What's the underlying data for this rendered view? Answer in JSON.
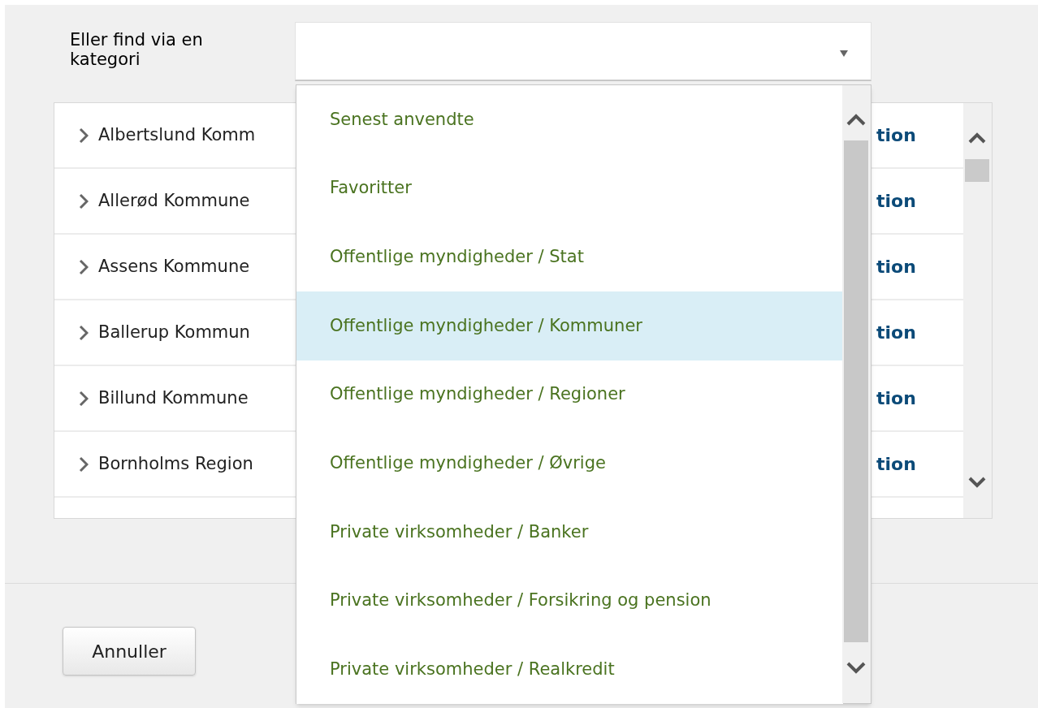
{
  "category_label": "Eller find via en kategori",
  "category_select": {
    "expanded": true
  },
  "dropdown_options": [
    {
      "label": "Senest anvendte",
      "selected": false
    },
    {
      "label": "Favoritter",
      "selected": false
    },
    {
      "label": "Offentlige myndigheder / Stat",
      "selected": false
    },
    {
      "label": "Offentlige myndigheder / Kommuner",
      "selected": true
    },
    {
      "label": "Offentlige myndigheder / Regioner",
      "selected": false
    },
    {
      "label": "Offentlige myndigheder / Øvrige",
      "selected": false
    },
    {
      "label": "Private virksomheder / Banker",
      "selected": false
    },
    {
      "label": "Private virksomheder / Forsikring og pension",
      "selected": false
    },
    {
      "label": "Private virksomheder / Realkredit",
      "selected": false
    }
  ],
  "table": {
    "rows": [
      {
        "name": "Albertslund Komm",
        "link": "tion"
      },
      {
        "name": "Allerød Kommune",
        "link": "tion"
      },
      {
        "name": "Assens Kommune",
        "link": "tion"
      },
      {
        "name": "Ballerup Kommun",
        "link": "tion"
      },
      {
        "name": "Billund Kommune",
        "link": "tion"
      },
      {
        "name": "Bornholms Region",
        "link": "tion"
      }
    ]
  },
  "buttons": [
    "Annuller"
  ]
}
